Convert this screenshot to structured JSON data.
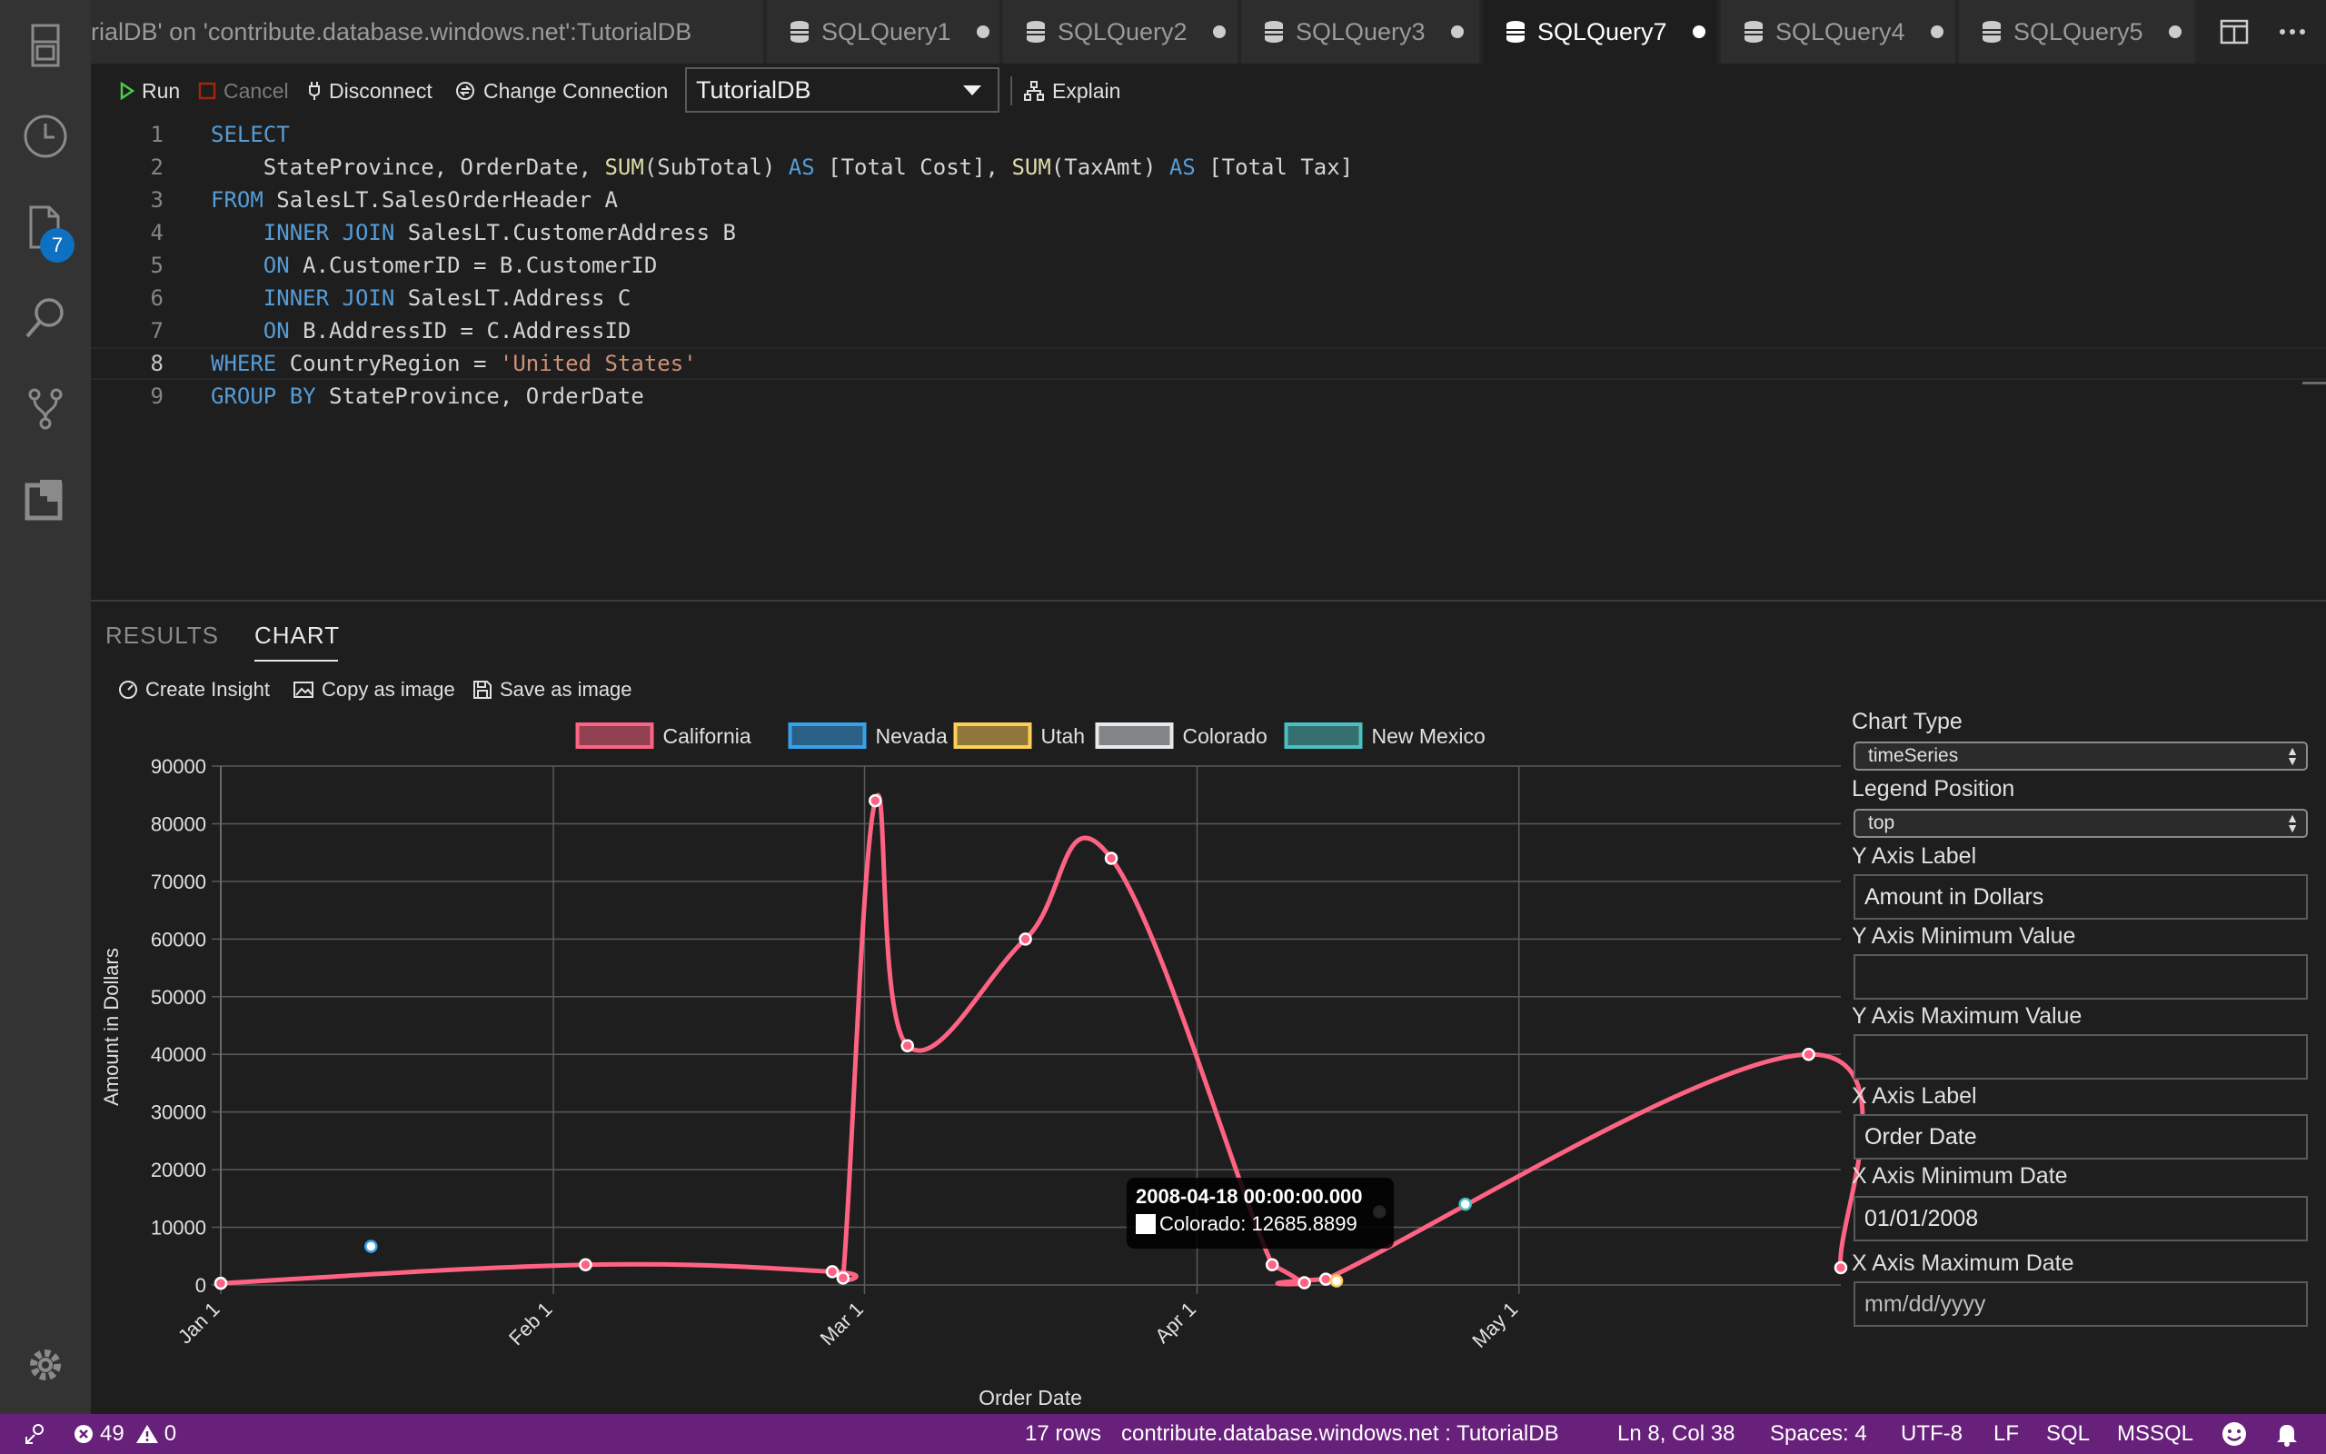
{
  "activity_bar": {
    "icons": [
      "explorer-icon",
      "history-icon",
      "files-icon",
      "search-icon",
      "source-control-icon",
      "extensions-icon",
      "settings-gear-icon"
    ],
    "files_badge": "7"
  },
  "tabs": [
    {
      "label": "rialDB' on 'contribute.database.windows.net':TutorialDB",
      "active": false,
      "dirty": false
    },
    {
      "label": "SQLQuery1",
      "active": false,
      "dirty": true
    },
    {
      "label": "SQLQuery2",
      "active": false,
      "dirty": true
    },
    {
      "label": "SQLQuery3",
      "active": false,
      "dirty": true
    },
    {
      "label": "SQLQuery7",
      "active": true,
      "dirty": true
    },
    {
      "label": "SQLQuery4",
      "active": false,
      "dirty": true
    },
    {
      "label": "SQLQuery5",
      "active": false,
      "dirty": true
    }
  ],
  "toolbar": {
    "run": "Run",
    "cancel": "Cancel",
    "disconnect": "Disconnect",
    "change_connection": "Change Connection",
    "database": "TutorialDB",
    "explain": "Explain"
  },
  "editor": {
    "line_numbers": [
      "1",
      "2",
      "3",
      "4",
      "5",
      "6",
      "7",
      "8",
      "9"
    ],
    "current_line": 8
  },
  "panel": {
    "tabs": [
      "RESULTS",
      "CHART"
    ],
    "active_tab": "CHART",
    "actions": {
      "create_insight": "Create Insight",
      "copy_image": "Copy as image",
      "save_image": "Save as image"
    }
  },
  "chart_data": {
    "type": "line",
    "legend_position": "top",
    "ylabel": "Amount in Dollars",
    "xlabel": "Order Date",
    "ylim": [
      0,
      90000
    ],
    "y_ticks": [
      "90000",
      "80000",
      "70000",
      "60000",
      "50000",
      "40000",
      "30000",
      "20000",
      "10000",
      "0"
    ],
    "x_ticks": [
      "Jan 1",
      "Feb 1",
      "Mar 1",
      "Apr 1",
      "May 1"
    ],
    "x_tick_dates": [
      "2008-01-01",
      "2008-02-01",
      "2008-03-01",
      "2008-04-01",
      "2008-05-01"
    ],
    "x_range": [
      "2008-01-01",
      "2008-05-31"
    ],
    "series": [
      {
        "name": "California",
        "color": "#ff6384",
        "points": [
          {
            "x": "2008-01-01",
            "y": 300
          },
          {
            "x": "2008-02-04",
            "y": 3500
          },
          {
            "x": "2008-02-27",
            "y": 2300
          },
          {
            "x": "2008-02-28",
            "y": 1200
          },
          {
            "x": "2008-03-02",
            "y": 84000
          },
          {
            "x": "2008-03-05",
            "y": 41500
          },
          {
            "x": "2008-03-16",
            "y": 60000
          },
          {
            "x": "2008-03-24",
            "y": 74000
          },
          {
            "x": "2008-04-08",
            "y": 3500
          },
          {
            "x": "2008-04-11",
            "y": 400
          },
          {
            "x": "2008-04-13",
            "y": 1000
          },
          {
            "x": "2008-05-28",
            "y": 40000
          },
          {
            "x": "2008-05-31",
            "y": 3000
          }
        ]
      },
      {
        "name": "Nevada",
        "color": "#36a2eb",
        "points": [
          {
            "x": "2008-01-15",
            "y": 6700
          }
        ]
      },
      {
        "name": "Utah",
        "color": "#ffce56",
        "points": [
          {
            "x": "2008-04-14",
            "y": 700
          }
        ]
      },
      {
        "name": "Colorado",
        "color": "#e7e9ed",
        "points": [
          {
            "x": "2008-04-18",
            "y": 12685.8899
          }
        ]
      },
      {
        "name": "New Mexico",
        "color": "#4bc0c0",
        "points": [
          {
            "x": "2008-04-26",
            "y": 14000
          }
        ]
      }
    ],
    "tooltip": {
      "title": "2008-04-18 00:00:00.000",
      "label": "Colorado: 12685.8899"
    }
  },
  "chart_options": {
    "chart_type_label": "Chart Type",
    "chart_type_value": "timeSeries",
    "legend_position_label": "Legend Position",
    "legend_position_value": "top",
    "y_axis_label_label": "Y Axis Label",
    "y_axis_label_value": "Amount in Dollars",
    "y_axis_min_label": "Y Axis Minimum Value",
    "y_axis_min_value": "",
    "y_axis_max_label": "Y Axis Maximum Value",
    "y_axis_max_value": "",
    "x_axis_label_label": "X Axis Label",
    "x_axis_label_value": "Order Date",
    "x_axis_min_label": "X Axis Minimum Date",
    "x_axis_min_value": "01/01/2008",
    "x_axis_max_label": "X Axis Maximum Date",
    "x_axis_max_placeholder": "mm/dd/yyyy"
  },
  "status_bar": {
    "errors": "49",
    "warnings": "0",
    "rows": "17 rows",
    "connection": "contribute.database.windows.net : TutorialDB",
    "position": "Ln 8, Col 38",
    "spaces": "Spaces: 4",
    "encoding": "UTF-8",
    "eol": "LF",
    "language": "SQL",
    "provider": "MSSQL"
  },
  "colors": {
    "status_bar": "#68217a",
    "accent_badge": "#0e70c0"
  }
}
